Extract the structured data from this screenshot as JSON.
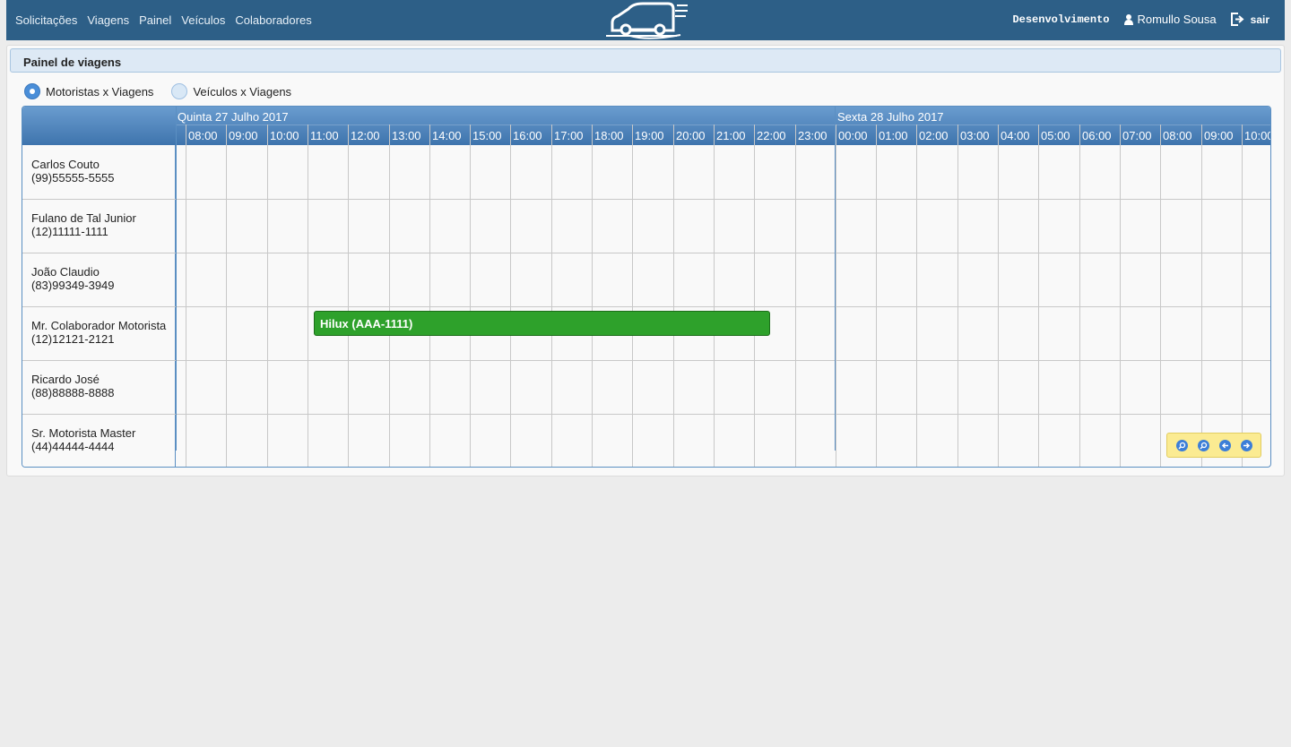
{
  "navbar": {
    "links": [
      "Solicitações",
      "Viagens",
      "Painel",
      "Veículos",
      "Colaboradores"
    ],
    "environment": "Desenvolvimento",
    "user_name": "Romullo Sousa",
    "logout_label": "sair",
    "brand_color": "#2d5f87"
  },
  "panel": {
    "title": "Painel de viagens",
    "view_options": [
      {
        "label": "Motoristas x Viagens",
        "checked": true
      },
      {
        "label": "Veículos x Viagens",
        "checked": false
      }
    ]
  },
  "gantt": {
    "days": [
      "Quinta 27 Julho 2017",
      "Sexta 28 Julho 2017"
    ],
    "hours": [
      "08:00",
      "09:00",
      "10:00",
      "11:00",
      "12:00",
      "13:00",
      "14:00",
      "15:00",
      "16:00",
      "17:00",
      "18:00",
      "19:00",
      "20:00",
      "21:00",
      "22:00",
      "23:00",
      "00:00",
      "01:00",
      "02:00",
      "03:00",
      "04:00",
      "05:00",
      "06:00",
      "07:00",
      "08:00",
      "09:00",
      "10:00"
    ],
    "rows": [
      {
        "name": "Carlos Couto",
        "phone": "(99)55555-5555"
      },
      {
        "name": "Fulano de Tal Junior",
        "phone": "(12)11111-1111"
      },
      {
        "name": "João Claudio",
        "phone": "(83)99349-3949"
      },
      {
        "name": "Mr. Colaborador Motorista",
        "phone": "(12)12121-2121"
      },
      {
        "name": "Ricardo José",
        "phone": "(88)88888-8888"
      },
      {
        "name": "Sr. Motorista Master",
        "phone": "(44)44444-4444"
      }
    ],
    "trip": {
      "label": "Hilux (AAA-1111)",
      "driver": "Mr. Colaborador Motorista",
      "color": "#2ea12b"
    },
    "controls": [
      "zoom-in-icon",
      "zoom-out-icon",
      "arrow-left-icon",
      "arrow-right-icon"
    ]
  }
}
